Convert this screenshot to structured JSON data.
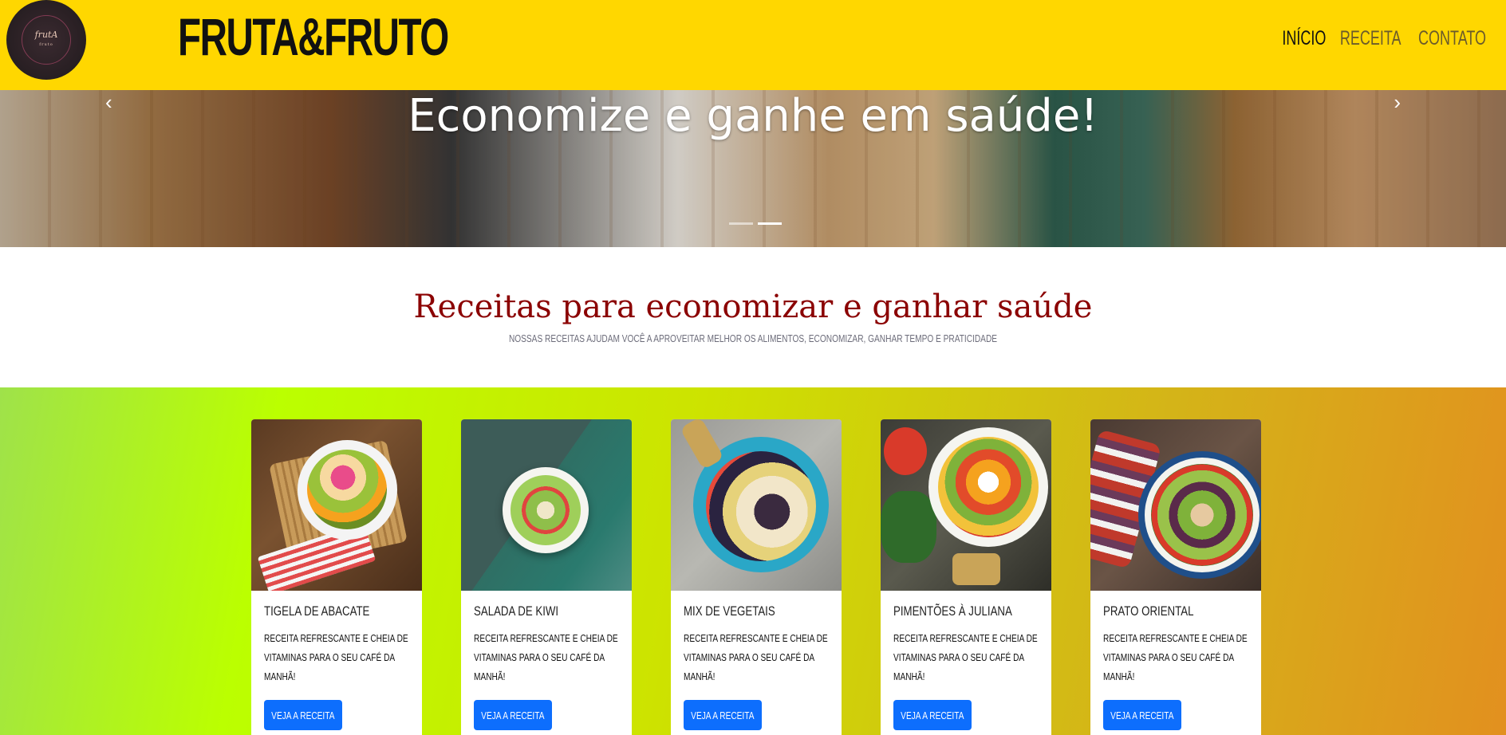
{
  "navbar": {
    "logo_text": "frutA",
    "logo_subtext": "fruto",
    "brand": "FRUTA&FRUTO",
    "links": [
      {
        "label": "INÍCIO",
        "active": true
      },
      {
        "label": "RECEITA",
        "active": false
      },
      {
        "label": "CONTATO",
        "active": false
      }
    ],
    "colors": {
      "background": "#FFD700",
      "active": "#111111",
      "inactive": "#6b5b2b"
    }
  },
  "hero": {
    "title": "Economize e ganhe em saúde!",
    "prev_icon": "chevron-left-icon",
    "next_icon": "chevron-right-icon",
    "slides": 2,
    "active_slide": 2
  },
  "intro": {
    "heading": "Receitas para economizar e ganhar saúde",
    "subheading": "Nossas receitas ajudam você a aproveitar melhor os alimentos, economizar, ganhar tempo e praticidade",
    "heading_color": "#8b0000"
  },
  "cards": [
    {
      "title": "TIGELA DE ABACATE",
      "text": "Receita refrescante e cheia de vitaminas para o seu café da manhã!",
      "button": "VEJA A RECEITA"
    },
    {
      "title": "SALADA DE KIWI",
      "text": "Receita refrescante e cheia de vitaminas para o seu café da manhã!",
      "button": "VEJA A RECEITA"
    },
    {
      "title": "MIX DE VEGETAIS",
      "text": "Receita refrescante e cheia de vitaminas para o seu café da manhã!",
      "button": "VEJA A RECEITA"
    },
    {
      "title": "PIMENTÕES À JULIANA",
      "text": "Receita refrescante e cheia de vitaminas para o seu café da manhã!",
      "button": "VEJA A RECEITA"
    },
    {
      "title": "PRATO ORIENTAL",
      "text": "Receita refrescante e cheia de vitaminas para o seu café da manhã!",
      "button": "VEJA A RECEITA"
    }
  ],
  "button_color": "#0d6efd"
}
